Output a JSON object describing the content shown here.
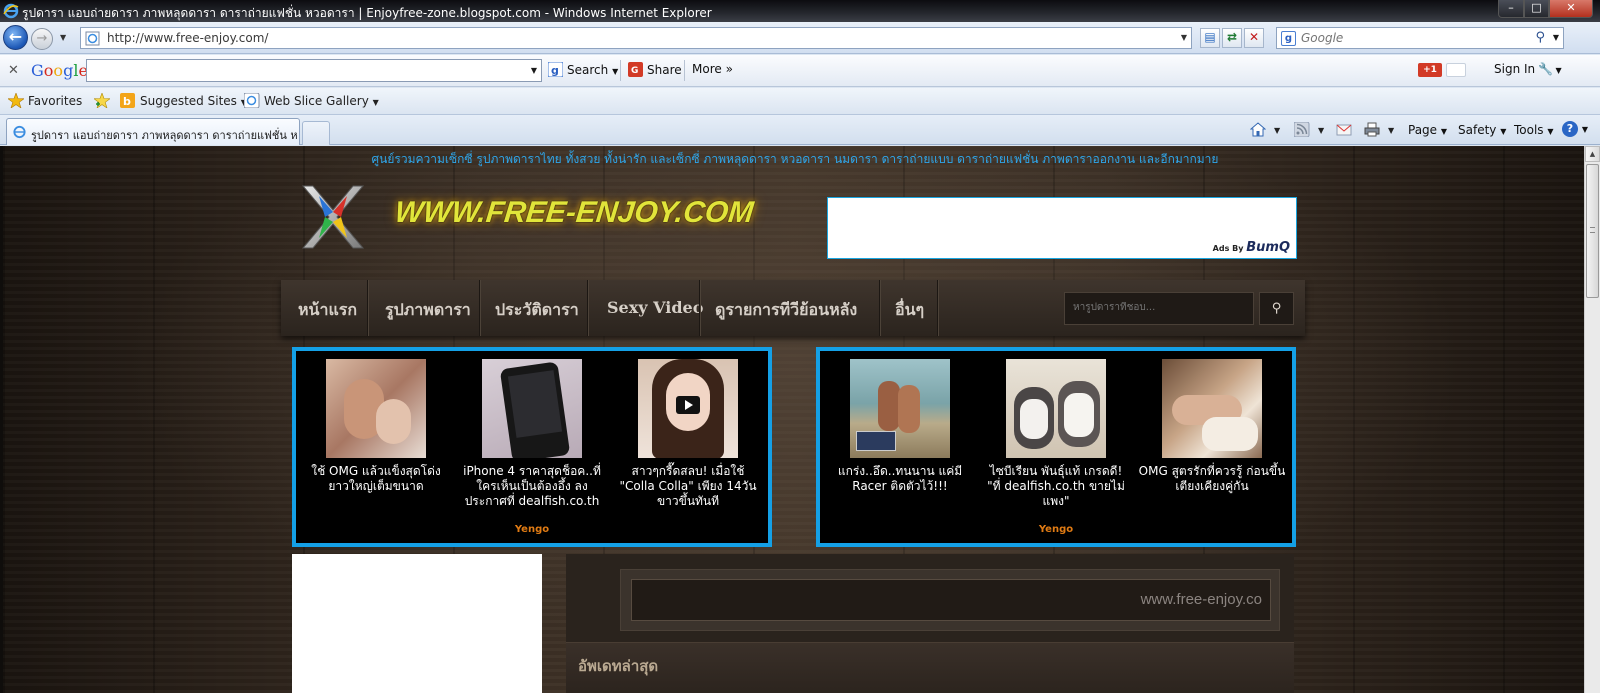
{
  "window": {
    "title": "รูปดารา แอบถ่ายดารา ภาพหลุดดารา ดาราถ่ายแฟชั่น หวอดารา | Enjoyfree-zone.blogspot.com - Windows Internet Explorer",
    "controls": {
      "minimize": "–",
      "maximize": "□",
      "close": "✕"
    }
  },
  "addressbar": {
    "url": "http://www.free-enjoy.com/",
    "search_placeholder": "Google"
  },
  "google_toolbar": {
    "logo": [
      "G",
      "o",
      "o",
      "g",
      "l",
      "e"
    ],
    "close": "✕",
    "search_label": "Search",
    "share_label": "Share",
    "more_label": "More »",
    "gplus_label": "+1",
    "signin_label": "Sign In"
  },
  "favorites_bar": {
    "favorites_label": "Favorites",
    "suggested_label": "Suggested Sites",
    "webslice_label": "Web Slice Gallery"
  },
  "tabs": [
    {
      "label": "รูปดารา แอบถ่ายดารา ภาพหลุดดารา ดาราถ่ายแฟชั่น หว..."
    }
  ],
  "command_bar": {
    "page_label": "Page",
    "safety_label": "Safety",
    "tools_label": "Tools",
    "help_label": "?"
  },
  "site": {
    "tagline": "ศูนย์รวมความเซ็กซี่ รูปภาพดาราไทย ทั้งสวย ทั้งน่ารัก และเซ็กซี่ ภาพหลุดดารา หวอดารา นมดารา ดาราถ่ายแบบ ดาราถ่ายแฟชั่น ภาพดาราออกงาน และอีกมากมาย",
    "logo_text": "WWW.FREE-ENJOY.COM",
    "ad_banner": {
      "ads_by": "Ads By",
      "brand": "BumQ"
    },
    "nav": {
      "items": [
        "หน้าแรก",
        "รูปภาพดารา",
        "ประวัติดารา",
        "Sexy Video",
        "ดูรายการทีวีย้อนหลัง",
        "อื่นๆ"
      ],
      "search_placeholder": "หารูปดาราที่ชอบ...",
      "search_icon": "⚲"
    },
    "ad_panels": [
      {
        "provider": "Yengo",
        "items": [
          {
            "caption": "ใช้ OMG แล้วแข็งสุดโด่ง ยาวใหญ่เต็มขนาด",
            "thumb": "couple-photo"
          },
          {
            "caption": "iPhone 4 ราคาสุดช็อค..ที่ใครเห็นเป็นต้องอึ้ง ลงประกาศที่ dealfish.co.th",
            "thumb": "phone-photo"
          },
          {
            "caption": "สาวๆกรี๊ดสลบ! เมื่อใช้ \"Colla Colla\" เพียง 14วัน ขาวขึ้นทันที",
            "thumb": "girl-video-photo"
          }
        ]
      },
      {
        "provider": "Yengo",
        "items": [
          {
            "caption": "แกร่ง..อึด..ทนนาน แค่มี Racer ติดตัวไว้!!!",
            "thumb": "beach-couple-photo"
          },
          {
            "caption": "ไซบีเรียน พันธุ์แท้ เกรดดี! \"ที่ dealfish.co.th ขายไม่แพง\"",
            "thumb": "husky-puppies-photo"
          },
          {
            "caption": "OMG สูตรรักที่ควรรู้ ก่อนขึ้นเตียงเคียงคู่กัน",
            "thumb": "bed-couple-photo"
          }
        ]
      }
    ],
    "marquee_text": "www.free-enjoy.co",
    "latest_heading": "อัพเดทล่าสุด"
  },
  "colors": {
    "accent_blue": "#14a0e6",
    "logo_yellow": "#e1e53a",
    "yengo_orange": "#e07b14"
  }
}
